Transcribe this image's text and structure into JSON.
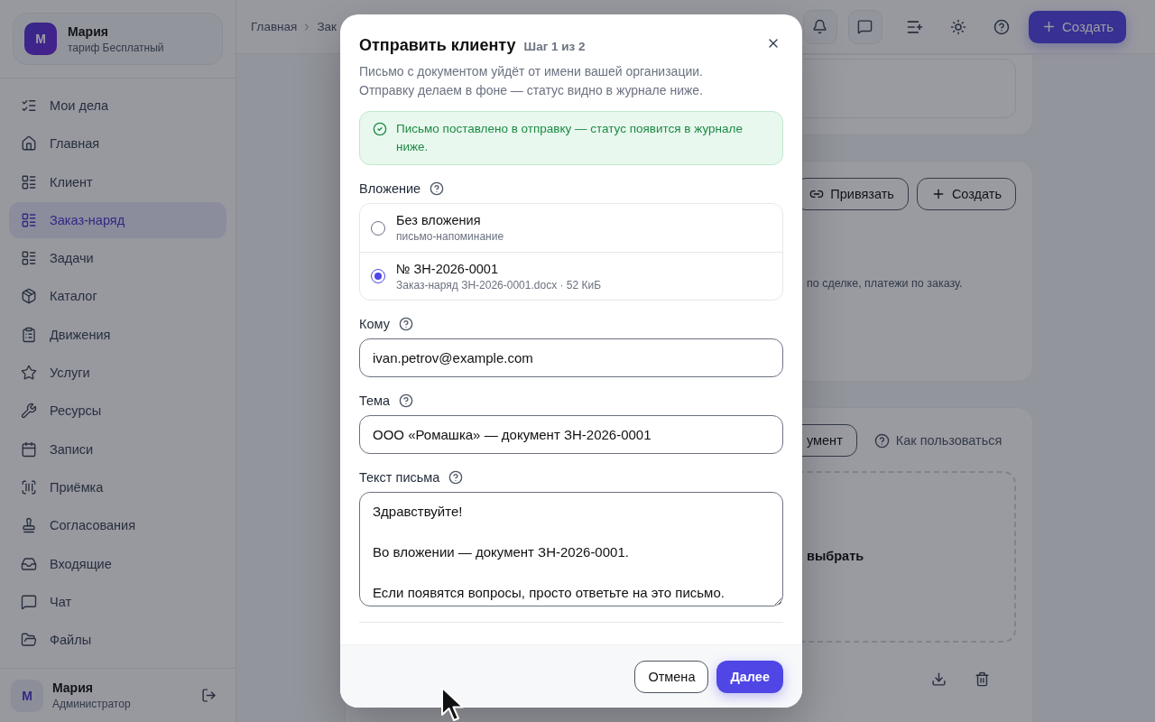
{
  "sidebar": {
    "account": {
      "avatar": "М",
      "name": "Мария",
      "plan": "тариф Бесплатный"
    },
    "items": [
      {
        "label": "Мои дела",
        "selected": false
      },
      {
        "label": "Главная",
        "selected": false
      },
      {
        "label": "Клиент",
        "selected": false
      },
      {
        "label": "Заказ-наряд",
        "selected": true
      },
      {
        "label": "Задачи",
        "selected": false
      },
      {
        "label": "Каталог",
        "selected": false
      },
      {
        "label": "Движения",
        "selected": false
      },
      {
        "label": "Услуги",
        "selected": false
      },
      {
        "label": "Ресурсы",
        "selected": false
      },
      {
        "label": "Записи",
        "selected": false
      },
      {
        "label": "Приёмка",
        "selected": false
      },
      {
        "label": "Согласования",
        "selected": false
      },
      {
        "label": "Входящие",
        "selected": false
      },
      {
        "label": "Чат",
        "selected": false
      },
      {
        "label": "Файлы",
        "selected": false
      }
    ],
    "user": {
      "avatar": "М",
      "name": "Мария",
      "role": "Администратор"
    }
  },
  "topbar": {
    "breadcrumbs": [
      "Главная",
      "Зак"
    ],
    "create_button": "Создать"
  },
  "content": {
    "links_card": {
      "buttons": [
        "Привязать",
        "Создать"
      ],
      "text": "по сделке, платежи по заказу."
    },
    "documents_card": {
      "button": "умент",
      "help_link": "Как пользоваться",
      "dropzone_title": "выбрать"
    }
  },
  "dialog": {
    "title": "Отправить клиенту",
    "step": "Шаг 1 из 2",
    "description": "Письмо с документом уйдёт от имени вашей организации.\nОтправку делаем в фоне — статус видно в журнале ниже.",
    "alert": "Письмо поставлено в отправку — статус появится в журнале ниже.",
    "attachment": {
      "label": "Вложение",
      "options": [
        {
          "title": "Без вложения",
          "subtitle": "письмо-напоминание",
          "selected": false
        },
        {
          "title": "№ ЗН-2026-0001",
          "subtitle": "Заказ-наряд ЗН-2026-0001.docx · 52 КиБ",
          "selected": true
        }
      ]
    },
    "to": {
      "label": "Кому",
      "value": "ivan.petrov@example.com"
    },
    "subject": {
      "label": "Тема",
      "value": "ООО «Ромашка» — документ ЗН-2026-0001"
    },
    "body": {
      "label": "Текст письма",
      "value": "Здравствуйте!\n\nВо вложении — документ ЗН-2026-0001.\n\nЕсли появятся вопросы, просто ответьте на это письмо."
    },
    "cancel_button": "Отмена",
    "next_button": "Далее"
  }
}
